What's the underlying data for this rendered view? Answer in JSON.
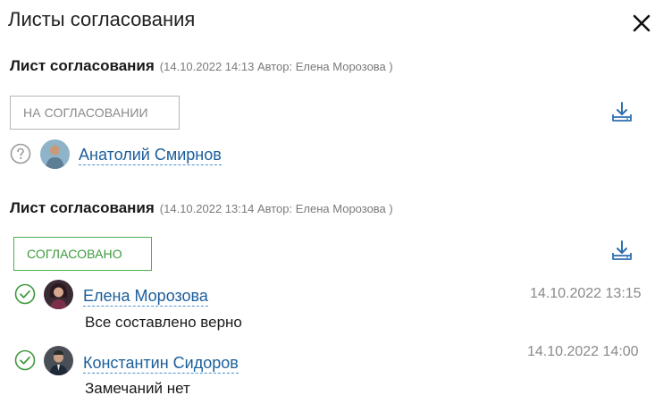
{
  "panel": {
    "title": "Листы согласования"
  },
  "sheets": [
    {
      "heading": "Лист согласования",
      "meta": "(14.10.2022 14:13 Автор: Елена Морозова )",
      "status": "НА СОГЛАСОВАНИИ",
      "approvers": [
        {
          "name": "Анатолий Смирнов",
          "state_icon": "question-icon",
          "date": "",
          "comment": ""
        }
      ]
    },
    {
      "heading": "Лист согласования",
      "meta": "(14.10.2022 13:14 Автор: Елена Морозова )",
      "status": "СОГЛАСОВАНО",
      "approvers": [
        {
          "name": "Елена Морозова",
          "state_icon": "check-circle-icon",
          "date": "14.10.2022 13:15",
          "comment": "Все составлено верно"
        },
        {
          "name": "Константин Сидоров",
          "state_icon": "check-circle-icon",
          "date": "14.10.2022 14:00",
          "comment": "Замечаний нет"
        }
      ]
    }
  ],
  "colors": {
    "link": "#1b5e9a",
    "approved": "#4caf50",
    "pending_border": "#b5b5b5",
    "icon_blue": "#2f6fb0"
  }
}
